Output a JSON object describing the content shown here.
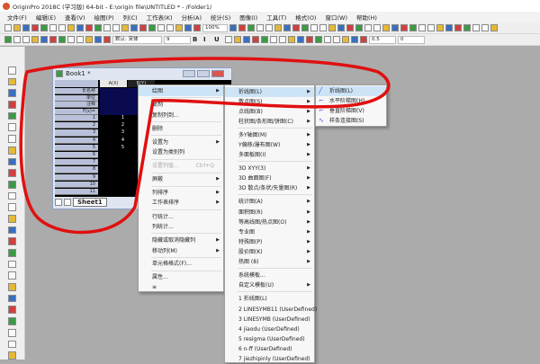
{
  "window": {
    "title": "OriginPro 2018C (学习版) 64-bit - E:\\origin file\\UNTITLED * - /Folder1/"
  },
  "menubar": [
    "文件(F)",
    "编辑(E)",
    "查看(V)",
    "绘图(P)",
    "列(C)",
    "工作表(K)",
    "分析(A)",
    "统计(S)",
    "图像(I)",
    "工具(T)",
    "格式(O)",
    "窗口(W)",
    "帮助(H)"
  ],
  "toolbar": {
    "zoom": "100%",
    "font": "默认: 宋体",
    "font_size": "9",
    "line_width": "0.5",
    "value": "0"
  },
  "book": {
    "title": "Book1 *",
    "col_a": "A(X)",
    "col_b": "B(Y)",
    "row_labels": [
      "长名称",
      "单位",
      "注释",
      "F(x)="
    ],
    "rows": [
      "1",
      "2",
      "3",
      "4",
      "5",
      "6",
      "7",
      "8",
      "9",
      "10",
      "11"
    ],
    "values": [
      "1",
      "2",
      "3",
      "4",
      "5"
    ],
    "sheet": "Sheet1"
  },
  "context_menu": [
    {
      "label": "绘图",
      "sub": true
    },
    {
      "label": "复制"
    },
    {
      "label": "复制列到..."
    },
    {
      "label": "删除"
    },
    {
      "label": "设置为",
      "sub": true
    },
    {
      "label": "设置为类别列"
    },
    {
      "label": "设置列值...",
      "shortcut": "Ctrl+Q",
      "disabled": true
    },
    {
      "label": "屏蔽",
      "sub": true
    },
    {
      "label": "列排序",
      "sub": true
    },
    {
      "label": "工作表排序",
      "sub": true
    },
    {
      "label": "行统计..."
    },
    {
      "label": "列统计..."
    },
    {
      "label": "隐藏或取消隐藏列",
      "sub": true
    },
    {
      "label": "移动列(M)",
      "sub": true
    },
    {
      "label": "单元格格式(F)..."
    },
    {
      "label": "属性..."
    },
    {
      "label": "≡"
    }
  ],
  "plot_menu": [
    {
      "label": "折线图(L)",
      "sub": true
    },
    {
      "label": "散点图(S)",
      "sub": true
    },
    {
      "label": "点线图(B)",
      "sub": true
    },
    {
      "label": "柱状图/条形图/饼图(C)",
      "sub": true
    },
    {
      "label": "多Y轴图(M)",
      "sub": true
    },
    {
      "label": "Y偏移/瀑布图(W)",
      "sub": true
    },
    {
      "label": "多面板图(I)",
      "sub": true
    },
    {
      "label": "3D XYY(3)",
      "sub": true
    },
    {
      "label": "3D 曲面图(F)",
      "sub": true
    },
    {
      "label": "3D 散点/条状/矢量图(R)",
      "sub": true
    },
    {
      "label": "统计图(A)",
      "sub": true
    },
    {
      "label": "面积图(R)",
      "sub": true
    },
    {
      "label": "等高线图/热点图(O)",
      "sub": true
    },
    {
      "label": "专业图",
      "sub": true
    },
    {
      "label": "特殊图(P)",
      "sub": true
    },
    {
      "label": "股价图(K)",
      "sub": true
    },
    {
      "label": "热图 (8)",
      "sub": true
    },
    {
      "label": "系统模板..."
    },
    {
      "label": "自定义模板(U)",
      "sub": true
    },
    {
      "label": "1 折线图(L)"
    },
    {
      "label": "2 LINESYMB11 (UserDefined)"
    },
    {
      "label": "3 LINESYMB (UserDefined)"
    },
    {
      "label": "4 jiaodu (UserDefined)"
    },
    {
      "label": "5 resigma (UserDefined)"
    },
    {
      "label": "6 n-ff (UserDefined)"
    },
    {
      "label": "7 jiezhipinly (UserDefined)"
    }
  ],
  "line_menu": [
    {
      "label": "折线图(L)"
    },
    {
      "label": "水平阶梯图(H)"
    },
    {
      "label": "垂直阶梯图(V)"
    },
    {
      "label": "样条连接图(S)"
    }
  ],
  "colors": {
    "annotation": "#e01010",
    "highlight": "#cde4f7",
    "grid": "#000000"
  }
}
